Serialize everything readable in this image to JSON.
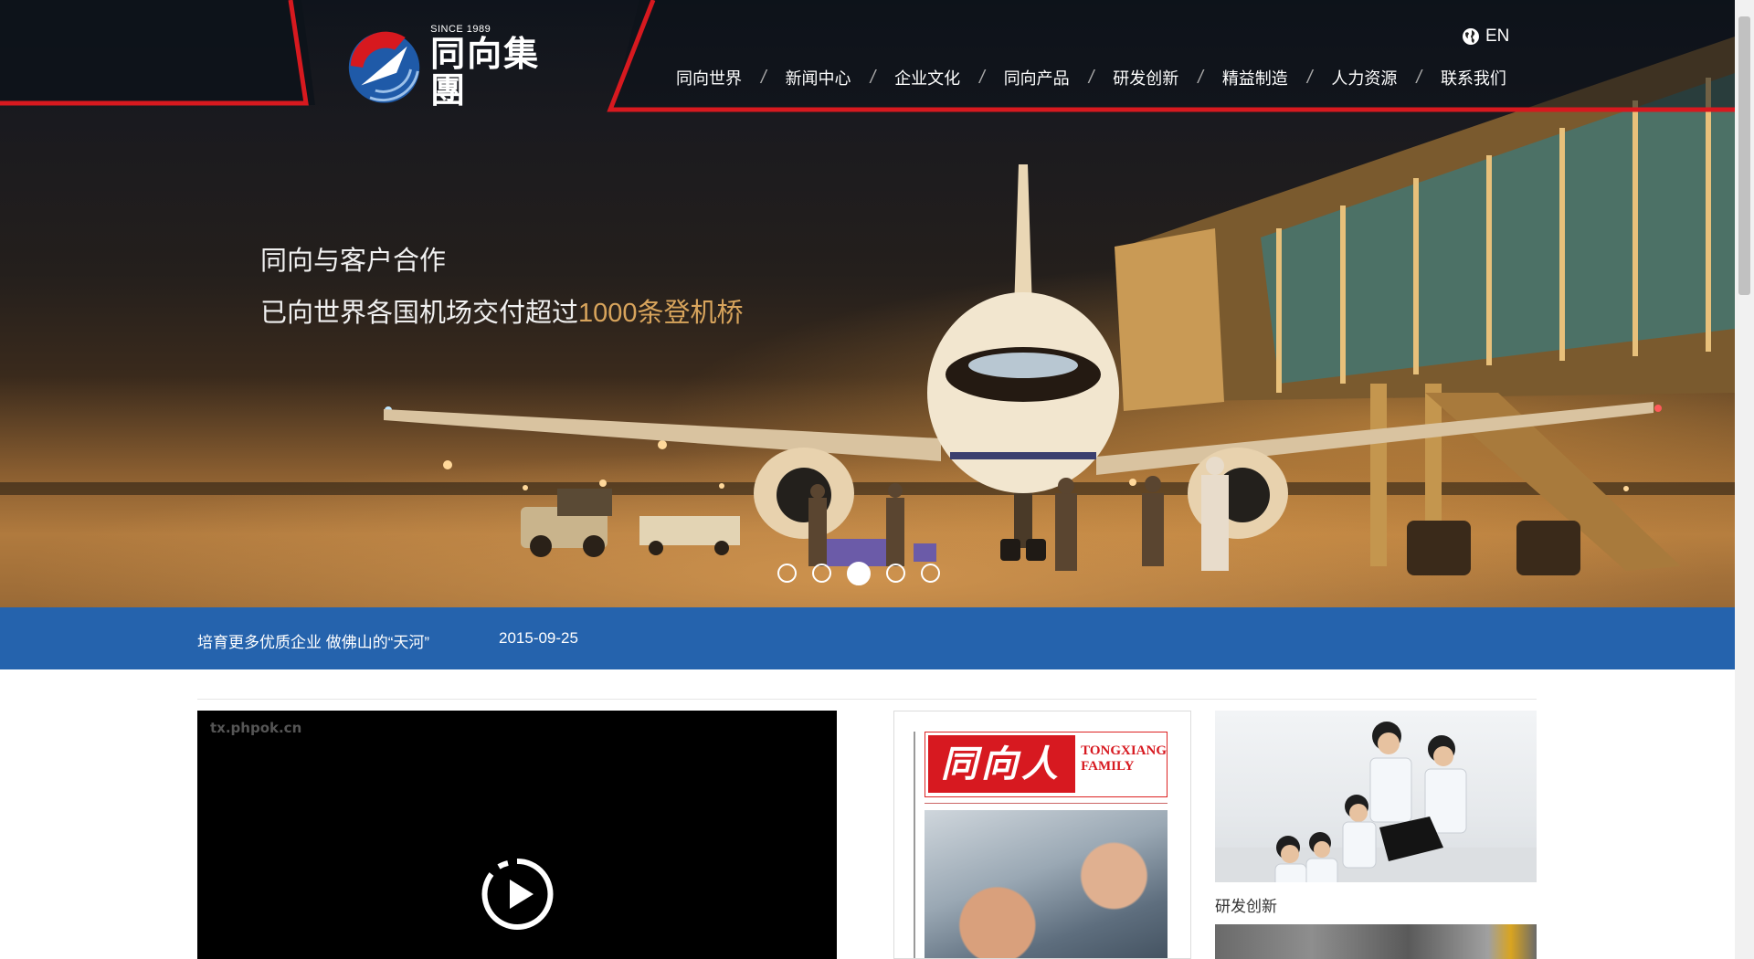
{
  "header": {
    "logo": {
      "since": "SINCE 1989",
      "name": "同向集團"
    },
    "lang": {
      "label": "EN",
      "icon": "globe-icon"
    },
    "nav": [
      "同向世界",
      "新闻中心",
      "企业文化",
      "同向产品",
      "研发创新",
      "精益制造",
      "人力资源",
      "联系我们"
    ],
    "nav_separator": "/"
  },
  "hero": {
    "line1": "同向与客户合作",
    "line2_prefix": "已向世界各国机场交付超过",
    "line2_highlight": "1000条登机桥",
    "slides_total": 5,
    "active_slide": 3,
    "highlight_color": "#d8a45c"
  },
  "news": {
    "title": "培育更多优质企业 做佛山的“天河”",
    "date": "2015-09-25",
    "bar_color": "#2563ad"
  },
  "content": {
    "video": {
      "watermark": "tx.phpok.cn",
      "play_icon": "play-icon"
    },
    "magazine": {
      "title_cn": "同向人",
      "title_en_1": "TONGXIANG",
      "title_en_2": "FAMILY",
      "accent": "#d71920"
    },
    "thumb1_label": "研发创新"
  }
}
